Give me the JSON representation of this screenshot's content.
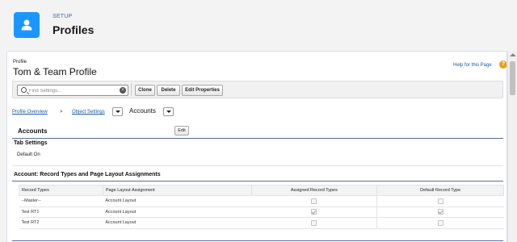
{
  "header": {
    "kicker": "SETUP",
    "title": "Profiles",
    "icon": "user-icon"
  },
  "profile": {
    "kicker": "Profile",
    "title": "Tom & Team Profile",
    "help_link": "Help for this Page",
    "help_icon": "?"
  },
  "toolbar": {
    "search_placeholder": "Find Settings...",
    "clear_icon": "×",
    "buttons": {
      "clone": "Clone",
      "delete": "Delete",
      "edit_properties": "Edit Properties"
    }
  },
  "breadcrumb": {
    "overview": "Profile Overview",
    "separator": ">",
    "object_settings": "Object Settings",
    "current": "Accounts"
  },
  "section": {
    "title": "Accounts",
    "edit_label": "Edit",
    "tab_settings": {
      "title": "Tab Settings",
      "value": "Default On"
    }
  },
  "record_types": {
    "title": "Account: Record Types and Page Layout Assignments",
    "columns": [
      "Record Types",
      "Page Layout Assignment",
      "Assigned Record Types",
      "Default Record Type"
    ],
    "rows": [
      {
        "name": "--Master--",
        "layout": "Account Layout",
        "assigned": false,
        "default": false
      },
      {
        "name": "Test RT1",
        "layout": "Account Layout",
        "assigned": true,
        "default": true
      },
      {
        "name": "Test RT2",
        "layout": "Account Layout",
        "assigned": false,
        "default": false
      }
    ]
  },
  "colors": {
    "accent": "#1b96ff",
    "link": "#1a5aa6",
    "section_rule": "#5b6e9f",
    "help_icon": "#e3a21a"
  }
}
